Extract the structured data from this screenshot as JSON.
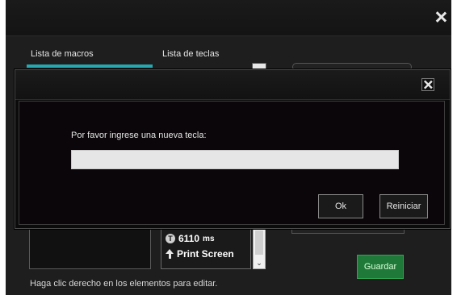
{
  "main_window": {
    "tabs": [
      {
        "label": "Lista de macros"
      },
      {
        "label": "Lista de teclas"
      }
    ],
    "key_list": {
      "items": [
        {
          "icon": "timer-icon",
          "icon_glyph": "T",
          "value": "6110",
          "unit": "ms"
        },
        {
          "icon": "key-up-arrow-icon",
          "value": "Print Screen"
        }
      ],
      "scroll_down_glyph": "⌄"
    },
    "save_button": "Guardar",
    "hint": "Haga clic derecho en los elementos para editar."
  },
  "dialog": {
    "prompt": "Por favor ingrese una nueva tecla:",
    "input_value": "",
    "ok_label": "Ok",
    "reset_label": "Reiniciar"
  },
  "colors": {
    "accent": "#25a8b0",
    "save_green": "#1f7a3a"
  }
}
